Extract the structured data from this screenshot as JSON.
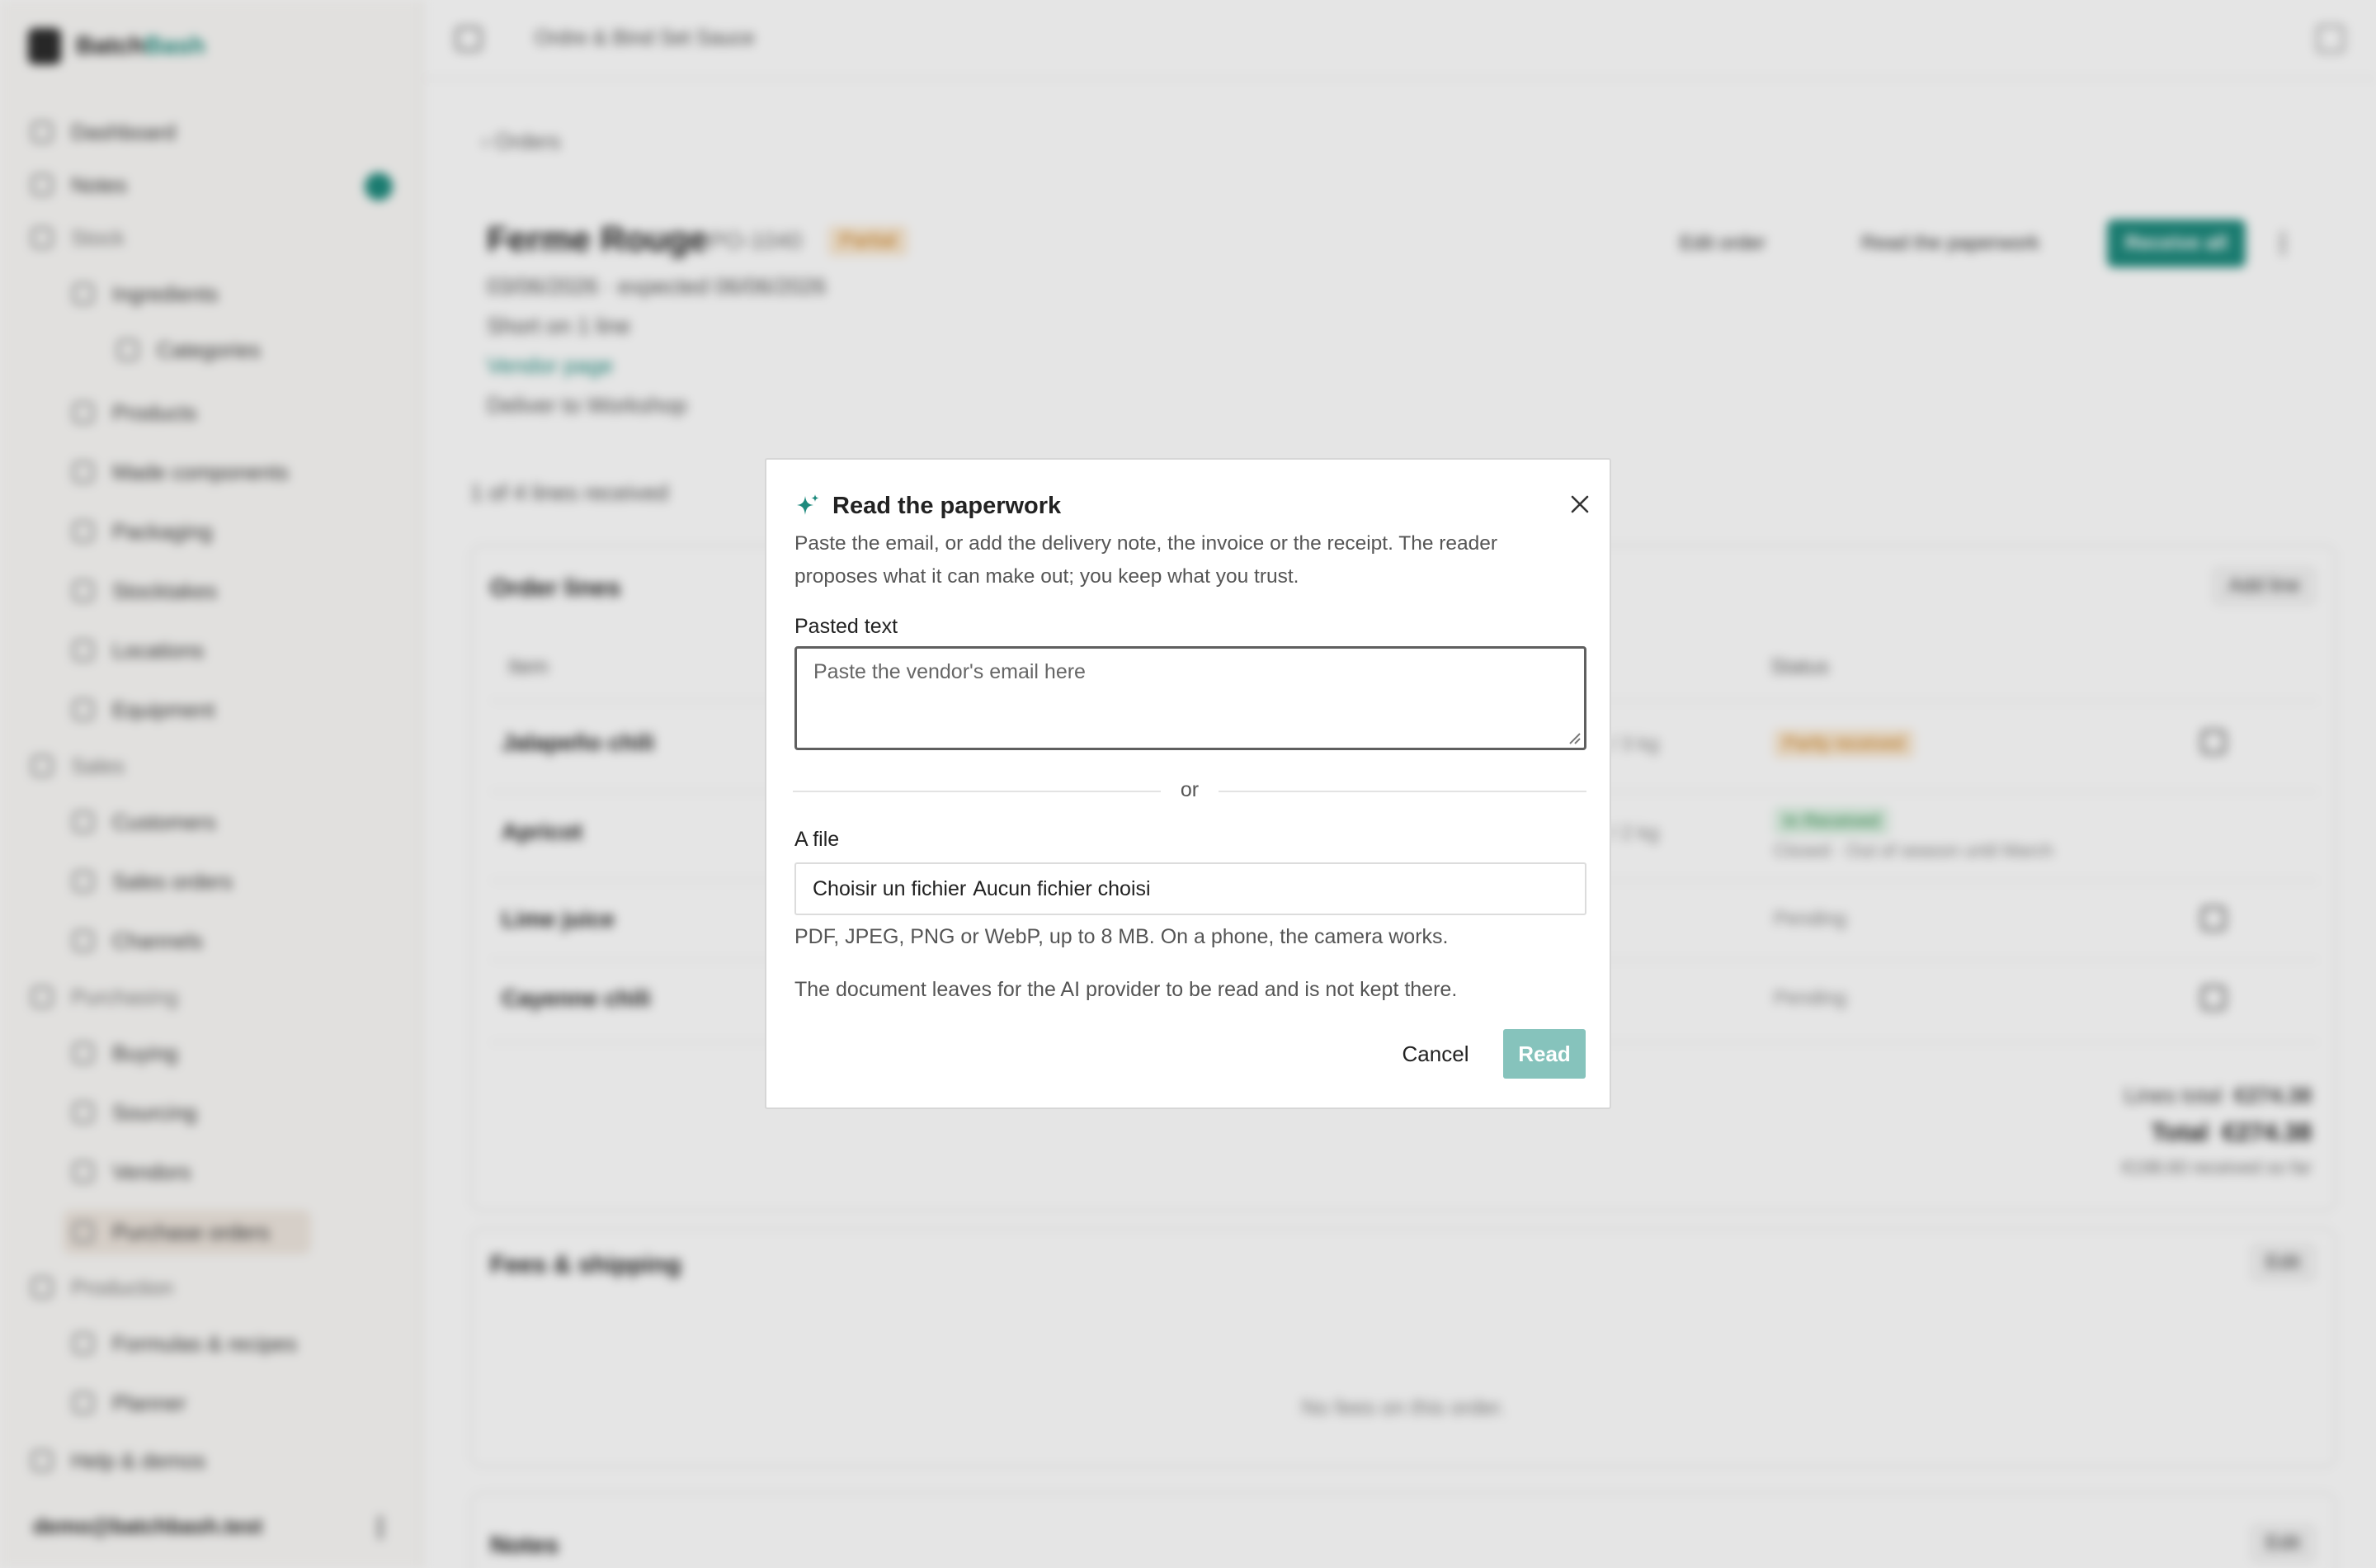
{
  "app": {
    "brand_main": "Batch",
    "brand_accent": "Bash",
    "breadcrumb": "Ordre & Bind Set Sauce",
    "sidebar": {
      "items": [
        {
          "label": "Dashboard"
        },
        {
          "label": "Notes"
        },
        {
          "label": "Stock"
        },
        {
          "label": "Ingredients"
        },
        {
          "label": "Categories"
        },
        {
          "label": "Products"
        },
        {
          "label": "Made components"
        },
        {
          "label": "Packaging"
        },
        {
          "label": "Stocktakes"
        },
        {
          "label": "Locations"
        },
        {
          "label": "Equipment"
        },
        {
          "label": "Sales"
        },
        {
          "label": "Customers"
        },
        {
          "label": "Sales orders"
        },
        {
          "label": "Channels"
        },
        {
          "label": "Purchasing"
        },
        {
          "label": "Buying"
        },
        {
          "label": "Sourcing"
        },
        {
          "label": "Vendors"
        },
        {
          "label": "Purchase orders"
        },
        {
          "label": "Production"
        },
        {
          "label": "Formulas & recipes"
        },
        {
          "label": "Planner"
        },
        {
          "label": "Help & demos"
        }
      ],
      "user": "demo@batchbash.test"
    },
    "order": {
      "back": "Orders",
      "title": "Ferme Rouge",
      "po": "PO-1040",
      "status": "Partial",
      "dates": "03/06/2026 · expected 06/06/2026",
      "short_line": "Short on 1 line",
      "vendor_link": "Vendor page",
      "deliver_to": "Deliver to Workshop",
      "edit_btn": "Edit order",
      "read_btn": "Read the paperwork",
      "receive_btn": "Receive all",
      "received_count": "1 of 4 lines received"
    },
    "lines_card": {
      "title": "Order lines",
      "action": "Add line",
      "col_item": "Item",
      "col_status": "Status",
      "rows": [
        {
          "name": "Jalapeño chili",
          "qty": "1 / 3 kg",
          "status": "Partly received"
        },
        {
          "name": "Apricot",
          "qty": "2 / 2 kg",
          "status": "In Received",
          "note": "Closed · Out of season until March"
        },
        {
          "name": "Lime juice",
          "status": "Pending"
        },
        {
          "name": "Cayenne chili",
          "status": "Pending"
        }
      ],
      "lines_total_label": "Lines total",
      "lines_total": "€274.38",
      "total_label": "Total",
      "total": "€274.38",
      "received_note": "€198.60 received so far"
    },
    "fees_card": {
      "title": "Fees & shipping",
      "action": "Edit",
      "empty": "No fees on this order."
    },
    "notes_card": {
      "title": "Notes",
      "action": "Edit"
    }
  },
  "dialog": {
    "title": "Read the paperwork",
    "description": "Paste the email, or add the delivery note, the invoice or the receipt. The reader proposes what it can make out; you keep what you trust.",
    "pasted_label": "Pasted text",
    "pasted_placeholder": "Paste the vendor's email here",
    "pasted_value": "",
    "or": "or",
    "file_label": "A file",
    "file_button": "Choisir un fichier",
    "file_status": "Aucun fichier choisi",
    "file_hint": "PDF, JPEG, PNG or WebP, up to 8 MB. On a phone, the camera works.",
    "privacy_note": "The document leaves for the AI provider to be read and is not kept there.",
    "cancel": "Cancel",
    "read": "Read",
    "icons": {
      "title_icon": "sparkle-icon",
      "close_icon": "close-icon"
    },
    "accent_color": "#1e8a7d",
    "read_disabled_color": "#86c3bc"
  }
}
